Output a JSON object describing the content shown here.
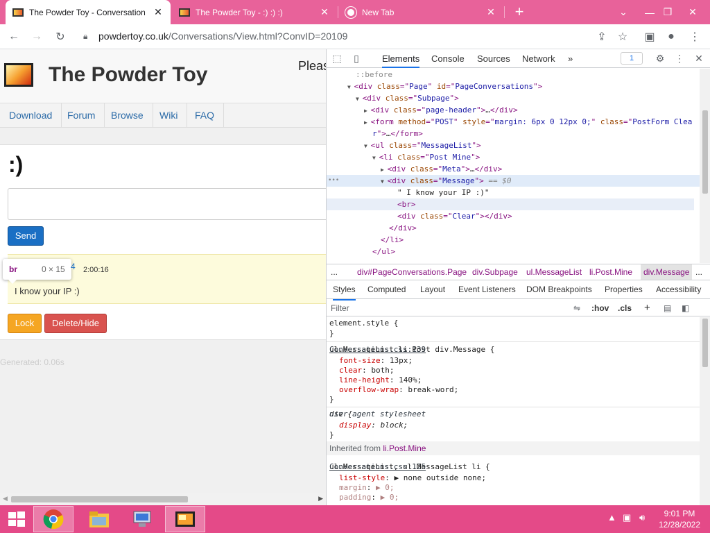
{
  "browser": {
    "tabs": [
      {
        "title": "The Powder Toy - Conversation",
        "active": true
      },
      {
        "title": "The Powder Toy - :) :) :)",
        "active": false
      },
      {
        "title": "New Tab",
        "active": false
      }
    ],
    "new_tab": "+",
    "url_domain": "powdertoy.co.uk",
    "url_path": "/Conversations/View.html?ConvID=20109"
  },
  "page": {
    "site_title": "The Powder Toy",
    "pleas_text": "Pleas",
    "nav": [
      "Download",
      "Forum",
      "Browse",
      "Wiki",
      "FAQ"
    ],
    "conversation_title": ":)",
    "send_label": "Send",
    "post_time": "2:00:16",
    "post_text": "I know your IP :)",
    "lock_label": "Lock",
    "delete_label": "Delete/Hide",
    "generated": "Generated: 0.06s",
    "tooltip_tag": "br",
    "tooltip_dim": "0 × 15"
  },
  "devtools": {
    "tabs": [
      "Elements",
      "Console",
      "Sources",
      "Network"
    ],
    "more": "»",
    "badge": "1",
    "dom_lines": [
      {
        "indent": 3,
        "arrow": "",
        "parts": [
          {
            "c": "pe",
            "t": "::before"
          }
        ]
      },
      {
        "indent": 2,
        "arrow": "▼",
        "parts": [
          {
            "c": "tg",
            "t": "<div "
          },
          {
            "c": "an",
            "t": "class"
          },
          {
            "c": "tg",
            "t": "=\""
          },
          {
            "c": "av",
            "t": "Page"
          },
          {
            "c": "tg",
            "t": "\" "
          },
          {
            "c": "an",
            "t": "id"
          },
          {
            "c": "tg",
            "t": "=\""
          },
          {
            "c": "av",
            "t": "PageConversations"
          },
          {
            "c": "tg",
            "t": "\">"
          }
        ]
      },
      {
        "indent": 3,
        "arrow": "▼",
        "parts": [
          {
            "c": "tg",
            "t": "<div "
          },
          {
            "c": "an",
            "t": "class"
          },
          {
            "c": "tg",
            "t": "=\""
          },
          {
            "c": "av",
            "t": "Subpage"
          },
          {
            "c": "tg",
            "t": "\">"
          }
        ]
      },
      {
        "indent": 4,
        "arrow": "▶",
        "parts": [
          {
            "c": "tg",
            "t": "<div "
          },
          {
            "c": "an",
            "t": "class"
          },
          {
            "c": "tg",
            "t": "=\""
          },
          {
            "c": "av",
            "t": "page-header"
          },
          {
            "c": "tg",
            "t": "\">"
          },
          {
            "c": "tx",
            "t": "…"
          },
          {
            "c": "tg",
            "t": "</div>"
          }
        ]
      },
      {
        "indent": 4,
        "arrow": "▶",
        "parts": [
          {
            "c": "tg",
            "t": "<form "
          },
          {
            "c": "an",
            "t": "method"
          },
          {
            "c": "tg",
            "t": "=\""
          },
          {
            "c": "av",
            "t": "POST"
          },
          {
            "c": "tg",
            "t": "\" "
          },
          {
            "c": "an",
            "t": "style"
          },
          {
            "c": "tg",
            "t": "=\""
          },
          {
            "c": "av",
            "t": "margin: 6px 0 12px 0;"
          },
          {
            "c": "tg",
            "t": "\" "
          },
          {
            "c": "an",
            "t": "class"
          },
          {
            "c": "tg",
            "t": "=\""
          },
          {
            "c": "av",
            "t": "PostForm Clea"
          }
        ]
      },
      {
        "indent": 5,
        "arrow": "",
        "parts": [
          {
            "c": "av",
            "t": "r"
          },
          {
            "c": "tg",
            "t": "\">"
          },
          {
            "c": "tx",
            "t": "…"
          },
          {
            "c": "tg",
            "t": "</form>"
          }
        ]
      },
      {
        "indent": 4,
        "arrow": "▼",
        "parts": [
          {
            "c": "tg",
            "t": "<ul "
          },
          {
            "c": "an",
            "t": "class"
          },
          {
            "c": "tg",
            "t": "=\""
          },
          {
            "c": "av",
            "t": "MessageList"
          },
          {
            "c": "tg",
            "t": "\">"
          }
        ]
      },
      {
        "indent": 5,
        "arrow": "▼",
        "parts": [
          {
            "c": "tg",
            "t": "<li "
          },
          {
            "c": "an",
            "t": "class"
          },
          {
            "c": "tg",
            "t": "=\""
          },
          {
            "c": "av",
            "t": "Post Mine"
          },
          {
            "c": "tg",
            "t": "\">"
          }
        ]
      },
      {
        "indent": 6,
        "arrow": "▶",
        "parts": [
          {
            "c": "tg",
            "t": "<div "
          },
          {
            "c": "an",
            "t": "class"
          },
          {
            "c": "tg",
            "t": "=\""
          },
          {
            "c": "av",
            "t": "Meta"
          },
          {
            "c": "tg",
            "t": "\">"
          },
          {
            "c": "tx",
            "t": "…"
          },
          {
            "c": "tg",
            "t": "</div>"
          }
        ]
      },
      {
        "indent": 6,
        "arrow": "▼",
        "sel": true,
        "parts": [
          {
            "c": "tg",
            "t": "<div "
          },
          {
            "c": "an",
            "t": "class"
          },
          {
            "c": "tg",
            "t": "=\""
          },
          {
            "c": "av",
            "t": "Message"
          },
          {
            "c": "tg",
            "t": "\">"
          },
          {
            "c": "eq",
            "t": " == $0"
          }
        ]
      },
      {
        "indent": 8,
        "arrow": "",
        "parts": [
          {
            "c": "tx",
            "t": "\" I know your IP :)\""
          }
        ]
      },
      {
        "indent": 8,
        "arrow": "",
        "hl": true,
        "parts": [
          {
            "c": "tg",
            "t": "<br>"
          }
        ]
      },
      {
        "indent": 8,
        "arrow": "",
        "parts": [
          {
            "c": "tg",
            "t": "<div "
          },
          {
            "c": "an",
            "t": "class"
          },
          {
            "c": "tg",
            "t": "=\""
          },
          {
            "c": "av",
            "t": "Clear"
          },
          {
            "c": "tg",
            "t": "\"></div>"
          }
        ]
      },
      {
        "indent": 7,
        "arrow": "",
        "parts": [
          {
            "c": "tg",
            "t": "</div>"
          }
        ]
      },
      {
        "indent": 6,
        "arrow": "",
        "parts": [
          {
            "c": "tg",
            "t": "</li>"
          }
        ]
      },
      {
        "indent": 5,
        "arrow": "",
        "parts": [
          {
            "c": "tg",
            "t": "</ul>"
          }
        ]
      }
    ],
    "crumbs": [
      "...",
      "div#PageConversations.Page",
      "div.Subpage",
      "ul.MessageList",
      "li.Post.Mine",
      "div.Message",
      "..."
    ],
    "style_tabs": [
      "Styles",
      "Computed",
      "Layout",
      "Event Listeners",
      "DOM Breakpoints",
      "Properties",
      "Accessibility"
    ],
    "filter_placeholder": "Filter",
    "hov": ":hov",
    "cls": ".cls",
    "rules": {
      "element_style": "element.style {",
      "close": "}",
      "rule1_selector": "ul.MessageList li.Post div.Message {",
      "rule1_source": "Conversations.css:139",
      "rule1_props": [
        {
          "n": "font-size",
          "v": "13px;"
        },
        {
          "n": "clear",
          "v": "both;"
        },
        {
          "n": "line-height",
          "v": "140%;"
        },
        {
          "n": "overflow-wrap",
          "v": "break-word;"
        }
      ],
      "rule2_selector": "div {",
      "rule2_source": "user agent stylesheet",
      "rule2_props": [
        {
          "n": "display",
          "v": "block;"
        }
      ],
      "inherited_label": "Inherited from",
      "inherited_node": "li.Post.Mine",
      "rule3_selector": "ul.MessageList, ul.MessageList li {",
      "rule3_source": "Conversations.css:125",
      "rule3_props": [
        {
          "n": "list-style",
          "v": "▶ none outside none;",
          "faded": false
        },
        {
          "n": "margin",
          "v": "▶ 0;",
          "faded": true
        },
        {
          "n": "padding",
          "v": "▶ 0;",
          "faded": true
        }
      ]
    }
  },
  "taskbar": {
    "time": "9:01 PM",
    "date": "12/28/2022"
  }
}
